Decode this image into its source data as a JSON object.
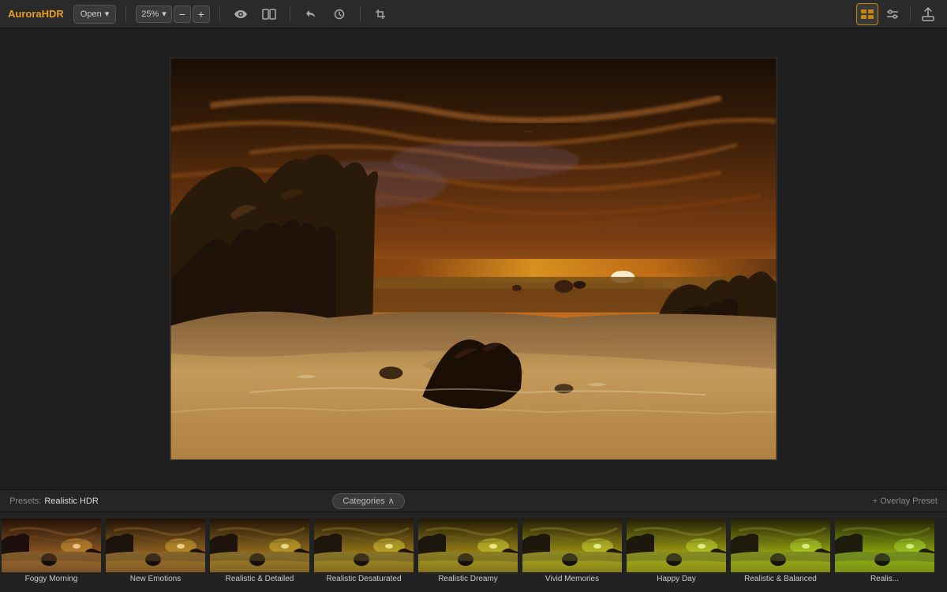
{
  "app": {
    "name": "AuroraHDR"
  },
  "toolbar": {
    "open_label": "Open",
    "zoom_value": "25%",
    "zoom_down_label": "▾",
    "zoom_minus": "−",
    "zoom_plus": "+",
    "eye_icon": "👁",
    "compare_icon": "⧉",
    "undo_icon": "↩",
    "history_icon": "🕐",
    "crop_icon": "⊡",
    "view_toggle_icon": "▦",
    "sliders_icon": "⚙",
    "export_icon": "↑"
  },
  "presets": {
    "label": "Presets:",
    "current": "Realistic HDR",
    "categories_label": "Categories",
    "overlay_label": "+ Overlay Preset",
    "items": [
      {
        "id": "foggy-morning",
        "label": "Foggy Morning",
        "active": false
      },
      {
        "id": "new-emotions",
        "label": "New Emotions",
        "active": false
      },
      {
        "id": "realistic-detailed",
        "label": "Realistic & Detailed",
        "active": false
      },
      {
        "id": "realistic-desaturated",
        "label": "Realistic Desaturated",
        "active": false
      },
      {
        "id": "realistic-dreamy",
        "label": "Realistic Dreamy",
        "active": false
      },
      {
        "id": "vivid-memories",
        "label": "Vivid Memories",
        "active": false
      },
      {
        "id": "happy-day",
        "label": "Happy Day",
        "active": false
      },
      {
        "id": "realistic-balanced",
        "label": "Realistic & Balanced",
        "active": false
      },
      {
        "id": "realis",
        "label": "Realis...",
        "active": false
      }
    ]
  }
}
